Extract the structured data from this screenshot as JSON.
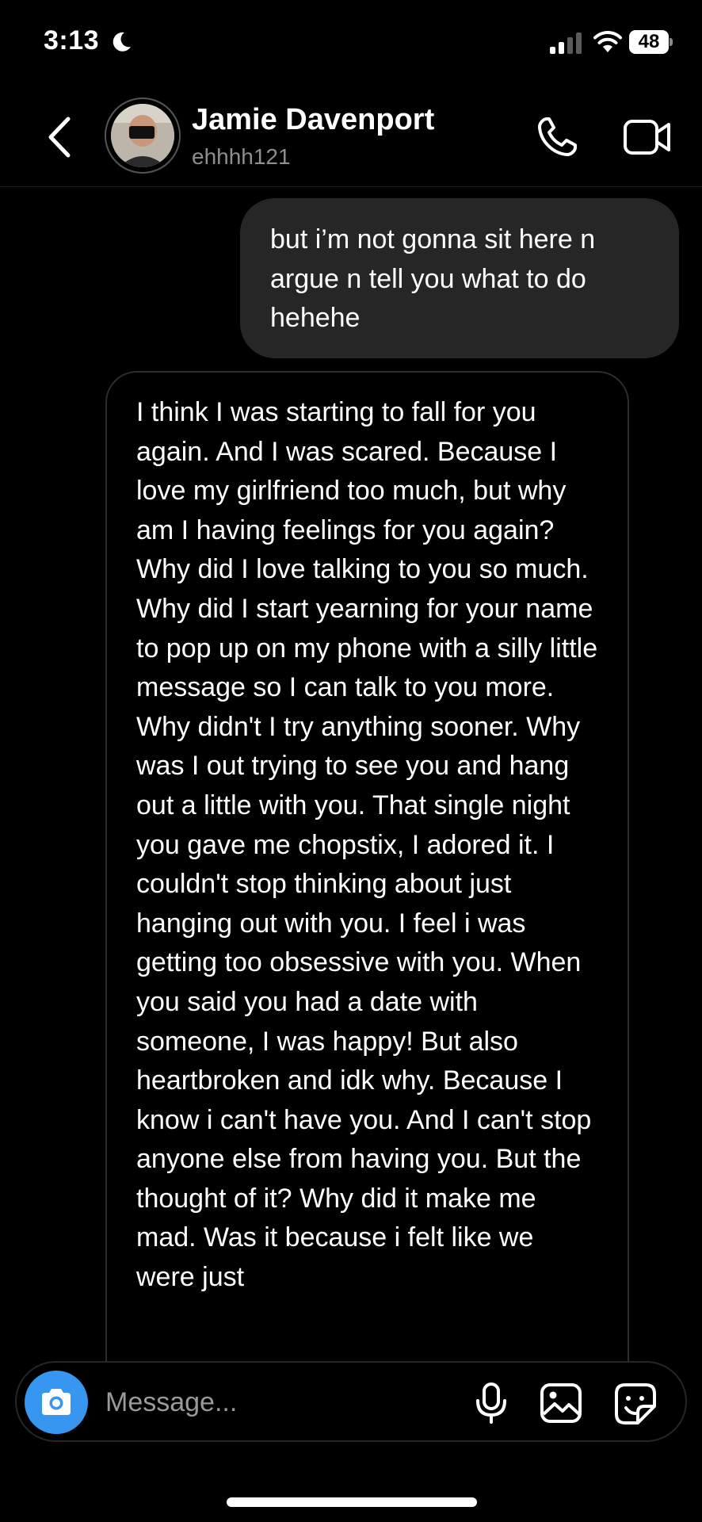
{
  "status_bar": {
    "time": "3:13",
    "battery": "48",
    "icons": [
      "moon-icon",
      "signal-icon",
      "wifi-icon",
      "battery-icon"
    ]
  },
  "header": {
    "name": "Jamie Davenport",
    "username": "ehhhh121",
    "icons": [
      "back-chevron-icon",
      "phone-icon",
      "video-camera-icon"
    ]
  },
  "messages": [
    {
      "direction": "sent",
      "text": "but i’m not gonna sit here n argue n tell you what to do hehehe"
    },
    {
      "direction": "received",
      "text": "I think I was starting to fall for you again. And I was scared. Because I love my girlfriend too much, but why am I having feelings for you again? Why did I love talking to you so much. Why did I start yearning for your name to pop up on my phone with a silly little message so I can talk to you more. Why didn't I try anything sooner. Why was I out trying to see you and hang out a little with you. That single night you gave me chopstix, I adored it. I couldn't stop thinking about just hanging out with you. I feel i was getting too obsessive with you. When you said you had a date with someone, I was happy! But also heartbroken and idk why. Because I know i can't have you. And I can't stop anyone else from having you. But the thought of it? Why did it make me mad. Was it because i felt like we were just"
    }
  ],
  "composer": {
    "placeholder": "Message...",
    "value": "",
    "icons": [
      "camera-icon",
      "microphone-icon",
      "gallery-icon",
      "sticker-icon"
    ]
  },
  "colors": {
    "background": "#000000",
    "sent_bubble": "#262626",
    "received_border": "#2e2e2e",
    "camera_button": "#3797f0",
    "secondary_text": "#8e8e8e"
  }
}
